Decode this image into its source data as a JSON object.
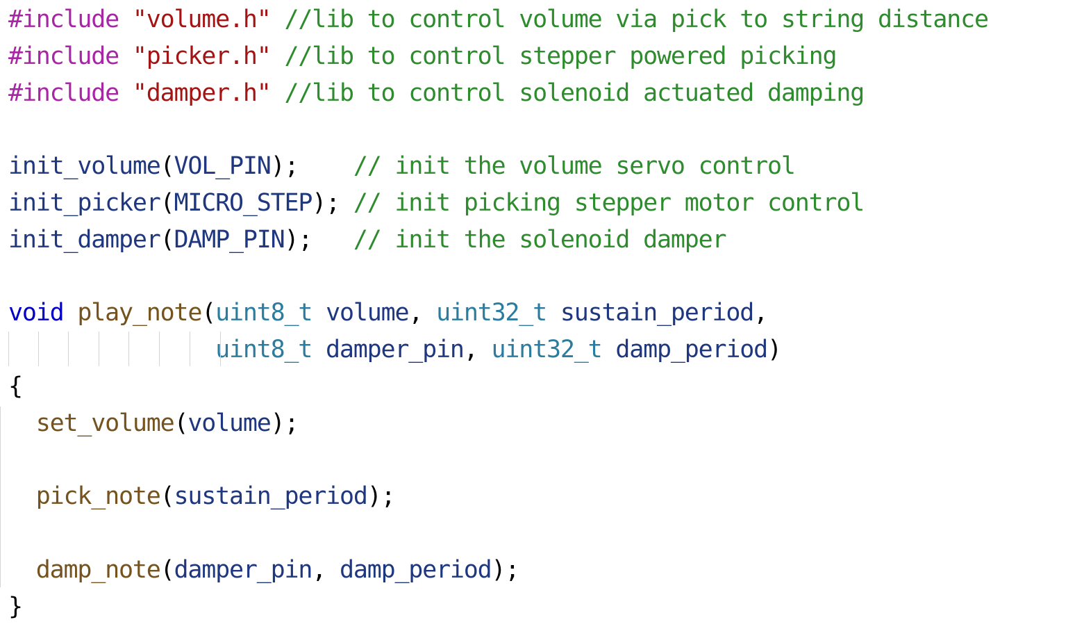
{
  "code": {
    "lines": [
      [
        {
          "t": "#include",
          "k": "directive"
        },
        {
          "t": " ",
          "k": "ident"
        },
        {
          "t": "\"volume.h\"",
          "k": "string"
        },
        {
          "t": " ",
          "k": "ident"
        },
        {
          "t": "//lib to control volume via pick to string distance",
          "k": "comment"
        }
      ],
      [
        {
          "t": "#include",
          "k": "directive"
        },
        {
          "t": " ",
          "k": "ident"
        },
        {
          "t": "\"picker.h\"",
          "k": "string"
        },
        {
          "t": " ",
          "k": "ident"
        },
        {
          "t": "//lib to control stepper powered picking",
          "k": "comment"
        }
      ],
      [
        {
          "t": "#include",
          "k": "directive"
        },
        {
          "t": " ",
          "k": "ident"
        },
        {
          "t": "\"damper.h\"",
          "k": "string"
        },
        {
          "t": " ",
          "k": "ident"
        },
        {
          "t": "//lib to control solenoid actuated damping",
          "k": "comment"
        }
      ],
      [],
      [
        {
          "t": "init_volume",
          "k": "ident"
        },
        {
          "t": "(",
          "k": "punct"
        },
        {
          "t": "VOL_PIN",
          "k": "ident"
        },
        {
          "t": ");",
          "k": "punct"
        },
        {
          "t": "    ",
          "k": "ident"
        },
        {
          "t": "// init the volume servo control",
          "k": "comment"
        }
      ],
      [
        {
          "t": "init_picker",
          "k": "ident"
        },
        {
          "t": "(",
          "k": "punct"
        },
        {
          "t": "MICRO_STEP",
          "k": "ident"
        },
        {
          "t": ");",
          "k": "punct"
        },
        {
          "t": " ",
          "k": "ident"
        },
        {
          "t": "// init picking stepper motor control",
          "k": "comment"
        }
      ],
      [
        {
          "t": "init_damper",
          "k": "ident"
        },
        {
          "t": "(",
          "k": "punct"
        },
        {
          "t": "DAMP_PIN",
          "k": "ident"
        },
        {
          "t": ");",
          "k": "punct"
        },
        {
          "t": "   ",
          "k": "ident"
        },
        {
          "t": "// init the solenoid damper",
          "k": "comment"
        }
      ],
      [],
      [
        {
          "t": "void",
          "k": "keyword"
        },
        {
          "t": " ",
          "k": "ident"
        },
        {
          "t": "play_note",
          "k": "func"
        },
        {
          "t": "(",
          "k": "punct"
        },
        {
          "t": "uint8_t",
          "k": "type"
        },
        {
          "t": " volume",
          "k": "ident"
        },
        {
          "t": ", ",
          "k": "punct"
        },
        {
          "t": "uint32_t",
          "k": "type"
        },
        {
          "t": " sustain_period",
          "k": "ident"
        },
        {
          "t": ",",
          "k": "punct"
        }
      ],
      [
        {
          "t": "               ",
          "k": "ident"
        },
        {
          "t": "uint8_t",
          "k": "type"
        },
        {
          "t": " damper_pin",
          "k": "ident"
        },
        {
          "t": ", ",
          "k": "punct"
        },
        {
          "t": "uint32_t",
          "k": "type"
        },
        {
          "t": " damp_period",
          "k": "ident"
        },
        {
          "t": ")",
          "k": "punct"
        }
      ],
      [
        {
          "t": "{",
          "k": "punct"
        }
      ],
      [
        {
          "t": "  ",
          "k": "ident"
        },
        {
          "t": "set_volume",
          "k": "func"
        },
        {
          "t": "(",
          "k": "punct"
        },
        {
          "t": "volume",
          "k": "ident"
        },
        {
          "t": ");",
          "k": "punct"
        }
      ],
      [],
      [
        {
          "t": "  ",
          "k": "ident"
        },
        {
          "t": "pick_note",
          "k": "func"
        },
        {
          "t": "(",
          "k": "punct"
        },
        {
          "t": "sustain_period",
          "k": "ident"
        },
        {
          "t": ");",
          "k": "punct"
        }
      ],
      [],
      [
        {
          "t": "  ",
          "k": "ident"
        },
        {
          "t": "damp_note",
          "k": "func"
        },
        {
          "t": "(",
          "k": "punct"
        },
        {
          "t": "damper_pin",
          "k": "ident"
        },
        {
          "t": ", ",
          "k": "punct"
        },
        {
          "t": "damp_period",
          "k": "ident"
        },
        {
          "t": ");",
          "k": "punct"
        }
      ],
      [
        {
          "t": "}",
          "k": "punct"
        }
      ]
    ]
  },
  "colors": {
    "directive": "#a626a4",
    "string": "#a31515",
    "comment": "#2e8b2e",
    "keyword": "#0000c8",
    "type": "#2b7c9e",
    "function": "#74531f",
    "identifier": "#1f377f",
    "punctuation": "#000000"
  }
}
